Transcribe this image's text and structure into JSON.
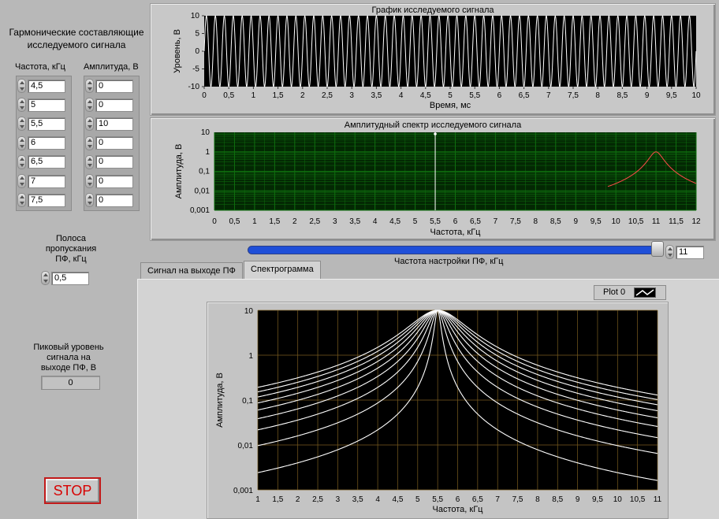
{
  "left": {
    "harmonics_title": "Гармонические составляющие исследуемого сигнала",
    "freq_header": "Частота, кГц",
    "amp_header": "Амплитуда, В",
    "frequencies": [
      "4,5",
      "5",
      "5,5",
      "6",
      "6,5",
      "7",
      "7,5"
    ],
    "amplitudes": [
      "0",
      "0",
      "10",
      "0",
      "0",
      "0",
      "0"
    ],
    "bandwidth_label": "Полоса пропускания ПФ, кГц",
    "bandwidth_value": "0,5",
    "peak_label": "Пиковый уровень сигнала на выходе ПФ, В",
    "peak_value": "0",
    "stop_label": "STOP"
  },
  "signal_graph": {
    "title": "График  исследуемого сигнала",
    "xlabel": "Время, мс",
    "ylabel": "Уровень, В",
    "yticks": [
      "10",
      "5",
      "0",
      "-5",
      "-10"
    ],
    "xticks": [
      "0",
      "0,5",
      "1",
      "1,5",
      "2",
      "2,5",
      "3",
      "3,5",
      "4",
      "4,5",
      "5",
      "5,5",
      "6",
      "6,5",
      "7",
      "7,5",
      "8",
      "8,5",
      "9",
      "9,5",
      "10"
    ]
  },
  "spectrum_graph": {
    "title": "Амплитудный спектр исследуемого сигнала",
    "xlabel": "Частота, кГц",
    "ylabel": "Амплитуда, В",
    "yticks": [
      "10",
      "1",
      "0,1",
      "0,01",
      "0,001"
    ],
    "xticks": [
      "0",
      "0,5",
      "1",
      "1,5",
      "2",
      "2,5",
      "3",
      "3,5",
      "4",
      "4,5",
      "5",
      "5,5",
      "6",
      "6,5",
      "7",
      "7,5",
      "8",
      "8,5",
      "9",
      "9,5",
      "10",
      "10,5",
      "11",
      "11,5",
      "12"
    ]
  },
  "tuning": {
    "label": "Частота настройки ПФ, кГц",
    "value": "11"
  },
  "tabs": [
    "Сигнал на выходе ПФ",
    "Спектрограмма"
  ],
  "spectrogram": {
    "legend": "Plot 0",
    "xlabel": "Частота, кГц",
    "ylabel": "Амплитуда, В",
    "yticks": [
      "10",
      "1",
      "0,1",
      "0,01",
      "0,001"
    ],
    "xticks": [
      "1",
      "1,5",
      "2",
      "2,5",
      "3",
      "3,5",
      "4",
      "4,5",
      "5",
      "5,5",
      "6",
      "6,5",
      "7",
      "7,5",
      "8",
      "8,5",
      "9",
      "9,5",
      "10",
      "10,5",
      "11"
    ]
  },
  "chart_data": [
    {
      "type": "line",
      "title": "График  исследуемого сигнала",
      "xlabel": "Время, мс",
      "ylabel": "Уровень, В",
      "xlim": [
        0,
        10
      ],
      "ylim": [
        -10,
        10
      ],
      "series": [
        {
          "frequency_khz": 5.5,
          "amplitude": 10
        }
      ]
    },
    {
      "type": "line",
      "title": "Амплитудный спектр исследуемого сигнала",
      "xlabel": "Частота, кГц",
      "ylabel": "Амплитуда, В",
      "xlim": [
        0,
        12
      ],
      "ylim": [
        0.001,
        10
      ],
      "yscale": "log",
      "marker_x": 5.5,
      "series": [
        {
          "center": 11,
          "peak": 1,
          "color": "#ff4a4a"
        }
      ]
    },
    {
      "type": "line",
      "xlabel": "Частота, кГц",
      "ylabel": "Амплитуда, В",
      "xlim": [
        1,
        11
      ],
      "ylim": [
        0.001,
        10
      ],
      "yscale": "log",
      "series": [
        {
          "name": "Plot 0",
          "center": 5.5,
          "peak": 10
        }
      ]
    }
  ],
  "colors": {
    "grid_green": "#0f6f0f",
    "plot_bg": "#000000",
    "slider": "#1f4fd8",
    "stop_red": "#d70000"
  }
}
